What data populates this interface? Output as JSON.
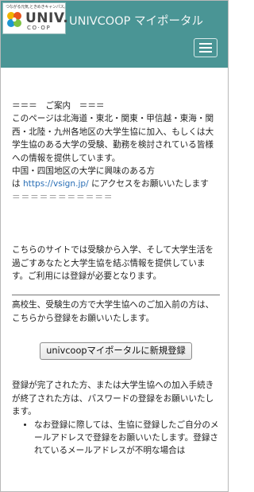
{
  "header": {
    "logo_tagline": "つながる元気,ときめきキャンパス。",
    "logo_univ": "UNIV.",
    "logo_coop": "CO·OP",
    "title": "UNIVCOOP マイポータル"
  },
  "notice": {
    "heading": "＝＝＝　ご案内　＝＝＝",
    "body": "このページは北海道・東北・関東・甲信越・東海・関西・北陸・九州各地区の大学生協に加入、もしくは大学生協のある大学の受験、勤務を検討されている皆様への情報を提供しています。",
    "chugoku_line": "中国・四国地区の大学に興味のある方",
    "link_prefix": "は ",
    "link_text": "https://vsign.jp/",
    "link_suffix": " にアクセスをお願いいたします",
    "separator": "＝＝＝＝＝＝＝＝＝＝＝"
  },
  "intro": "こちらのサイトでは受験から入学、そして大学生活を過ごすあなたと大学生協を結ぶ情報を提供しています。ご利用には登録が必要となります。",
  "highschool_note": "高校生、受験生の方で大学生協へのご加入前の方は、こちらから登録をお願いいたします。",
  "register_button": "univcoopマイポータルに新規登録",
  "password_note": "登録が完了された方、または大学生協への加入手続きが終了された方は、パスワードの登録をお願いいたします。",
  "bullets": [
    "なお登録に際しては、生協に登録したご自分のメールアドレスで登録をお願いいたします。登録されているメールアドレスが不明な場合は"
  ],
  "colors": {
    "header_bg": "#4a9595",
    "link": "#2a6fb6"
  }
}
